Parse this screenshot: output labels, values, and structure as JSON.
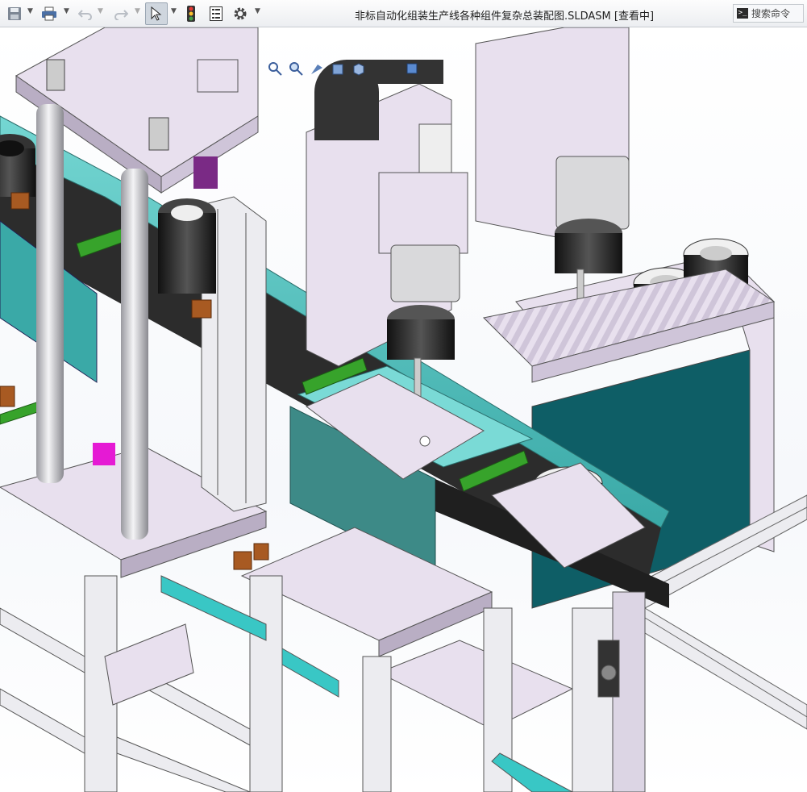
{
  "window": {
    "title": "非标自动化组装生产线各种组件复杂总装配图.SLDASM [查看中]"
  },
  "toolbar": {
    "buttons": [
      {
        "name": "save",
        "icon": "save-icon"
      },
      {
        "name": "print",
        "icon": "print-icon"
      },
      {
        "name": "undo",
        "icon": "undo-icon"
      },
      {
        "name": "redo",
        "icon": "redo-icon"
      },
      {
        "name": "select",
        "icon": "pointer-icon"
      },
      {
        "name": "rebuild",
        "icon": "traffic-light-icon"
      },
      {
        "name": "file-properties",
        "icon": "properties-icon"
      },
      {
        "name": "options",
        "icon": "gear-icon"
      }
    ]
  },
  "search": {
    "placeholder": "搜索命令"
  },
  "heads_up_toolbar": {
    "icons": [
      "zoom-to-fit-icon",
      "zoom-area-icon",
      "previous-view-icon",
      "section-view-icon",
      "view-orientation-icon",
      "display-style-icon",
      "hide-show-icon",
      "appearance-icon"
    ]
  },
  "colors": {
    "frame": "#e8e0ee",
    "frame_dark": "#b9aec4",
    "teal": "#5fc9c6",
    "teal_dark": "#0e5e66",
    "conveyor": "#2c2c2c",
    "green": "#37a32b",
    "orange": "#a85a22",
    "magenta": "#e51ad4",
    "steel": "#d4d4d8"
  }
}
